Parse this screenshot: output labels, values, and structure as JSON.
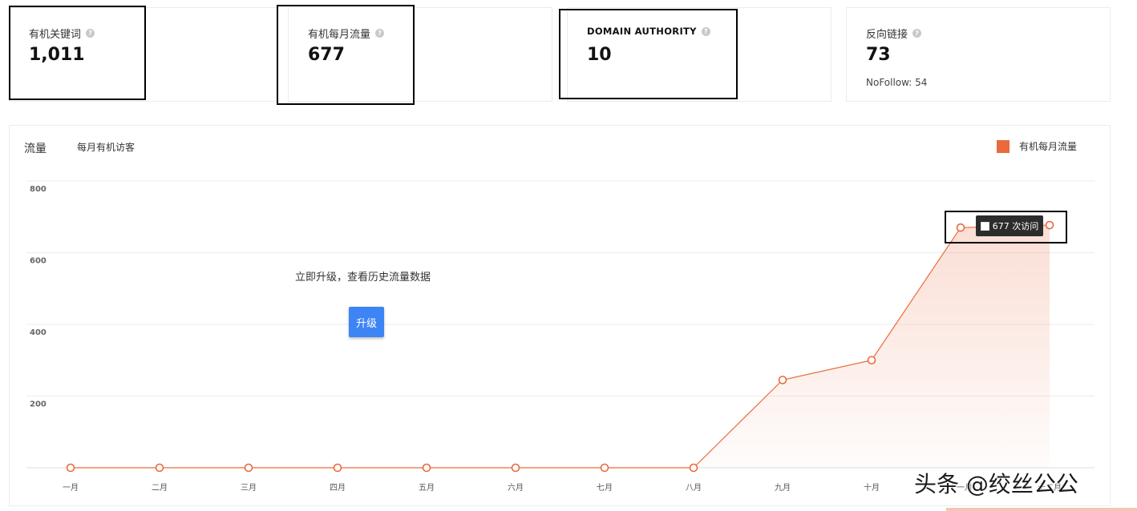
{
  "metrics": [
    {
      "label": "有机关键词",
      "value": "1,011",
      "help_icon": "question-icon"
    },
    {
      "label": "有机每月流量",
      "value": "677",
      "help_icon": "question-icon"
    },
    {
      "label": "DOMAIN AUTHORITY",
      "value": "10",
      "help_icon": "question-icon"
    },
    {
      "label": "反向链接",
      "value": "73",
      "sub": "NoFollow: 54",
      "help_icon": "question-icon"
    }
  ],
  "chart_panel": {
    "title": "流量",
    "subtitle": "每月有机访客",
    "legend_label": "有机每月流量",
    "tooltip": "677 次访问",
    "upgrade_text": "立即升级，查看历史流量数据",
    "upgrade_button": "升级"
  },
  "colors": {
    "series": "#ea6a3e",
    "button": "#3d84f5",
    "tooltip_bg": "#2c2c2c"
  },
  "chart_data": {
    "type": "area",
    "categories": [
      "一月",
      "二月",
      "三月",
      "四月",
      "五月",
      "六月",
      "七月",
      "八月",
      "九月",
      "十月",
      "十一月",
      "十二月"
    ],
    "series": [
      {
        "name": "有机每月流量",
        "values": [
          0,
          0,
          0,
          0,
          0,
          0,
          0,
          0,
          245,
          300,
          670,
          677
        ]
      }
    ],
    "yticks": [
      200,
      400,
      600,
      800
    ],
    "ylim": [
      0,
      800
    ],
    "grid": true,
    "legend": "top-right"
  },
  "watermark": "头条 @绞丝公公"
}
